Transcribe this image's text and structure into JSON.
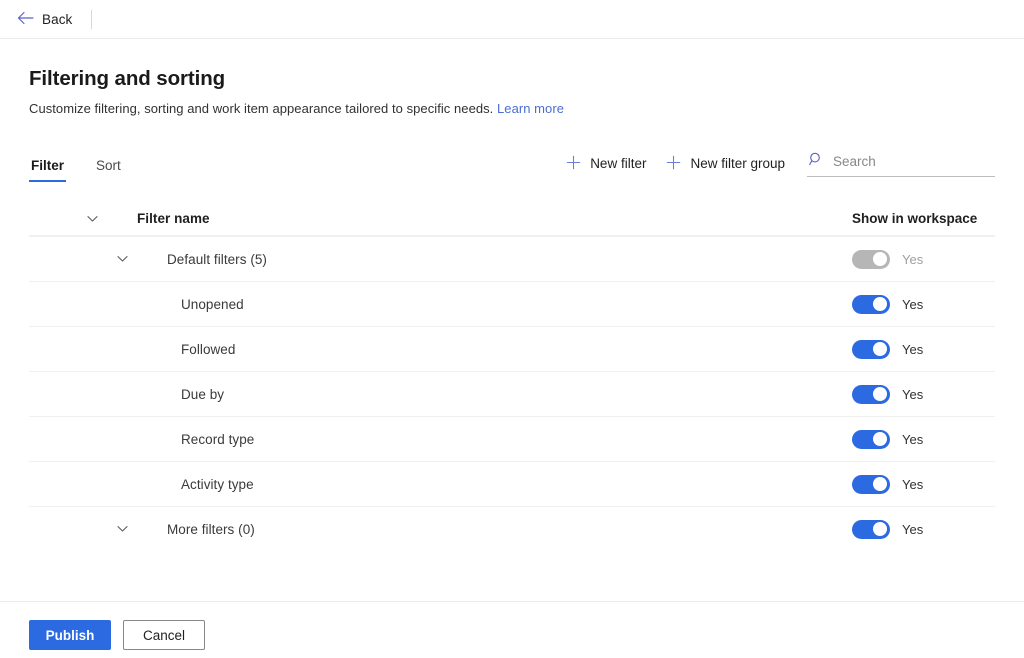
{
  "topbar": {
    "back_label": "Back",
    "back_icon": "arrow-left-icon"
  },
  "header": {
    "title": "Filtering and sorting",
    "subtitle": "Customize filtering, sorting and work item appearance tailored to specific needs.",
    "learn_more": "Learn more"
  },
  "tabs": [
    {
      "label": "Filter",
      "active": true
    },
    {
      "label": "Sort",
      "active": false
    }
  ],
  "toolbar": {
    "new_filter": "New filter",
    "new_filter_group": "New filter group",
    "plus_icon": "plus-icon",
    "search_icon": "search-icon",
    "search_placeholder": "Search",
    "search_value": ""
  },
  "table": {
    "columns": {
      "name": "Filter name",
      "show_in_workspace": "Show in workspace"
    },
    "header_chevron": "chevron-down-icon",
    "rows": [
      {
        "label": "Default filters (5)",
        "level": "group",
        "chevron": "chevron-down-icon",
        "toggle_on": true,
        "toggle_disabled": true,
        "toggle_label": "Yes"
      },
      {
        "label": "Unopened",
        "level": "child",
        "chevron": null,
        "toggle_on": true,
        "toggle_disabled": false,
        "toggle_label": "Yes"
      },
      {
        "label": "Followed",
        "level": "child",
        "chevron": null,
        "toggle_on": true,
        "toggle_disabled": false,
        "toggle_label": "Yes"
      },
      {
        "label": "Due by",
        "level": "child",
        "chevron": null,
        "toggle_on": true,
        "toggle_disabled": false,
        "toggle_label": "Yes"
      },
      {
        "label": "Record type",
        "level": "child",
        "chevron": null,
        "toggle_on": true,
        "toggle_disabled": false,
        "toggle_label": "Yes"
      },
      {
        "label": "Activity type",
        "level": "child",
        "chevron": null,
        "toggle_on": true,
        "toggle_disabled": false,
        "toggle_label": "Yes"
      },
      {
        "label": "More filters (0)",
        "level": "group",
        "chevron": "chevron-down-icon",
        "toggle_on": true,
        "toggle_disabled": false,
        "toggle_label": "Yes"
      }
    ]
  },
  "footer": {
    "publish": "Publish",
    "cancel": "Cancel"
  },
  "colors": {
    "accent": "#2b6ae0",
    "link": "#4a6fd4",
    "toggle_on": "#2b6ae0",
    "toggle_disabled": "#b6b6b6",
    "text": "#201f1e",
    "muted_text": "#a19f9d",
    "divider": "#f0f0f0"
  }
}
